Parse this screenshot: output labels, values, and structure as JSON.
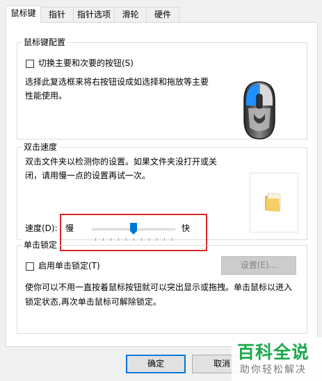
{
  "tabs": [
    {
      "label": "鼠标键"
    },
    {
      "label": "指针"
    },
    {
      "label": "指针选项"
    },
    {
      "label": "滑轮"
    },
    {
      "label": "硬件"
    }
  ],
  "button_config": {
    "title": "鼠标键配置",
    "switch_checkbox_label": "切换主要和次要的按钮(S)",
    "switch_checked": false,
    "description": "选择此复选框来将右按钮设成如选择和拖放等主要性能使用。"
  },
  "double_click": {
    "title": "双击速度",
    "description": "双击文件夹以检测你的设置。如果文件夹没打开或关闭，请用慢一点的设置再试一次。",
    "speed_label": "速度(D):",
    "slow_label": "慢",
    "fast_label": "快",
    "speed_level": 0.5
  },
  "click_lock": {
    "title": "单击锁定",
    "checkbox_label": "启用单击锁定(T)",
    "checked": false,
    "settings_button": "设置(E)...",
    "description": "使你可以不用一直按着鼠标按钮就可以突出显示或拖拽。单击鼠标以进入锁定状态,再次单击鼠标可解除锁定。"
  },
  "footer": {
    "ok": "确定",
    "cancel": "取消"
  },
  "watermark": {
    "line1": "百科全说",
    "line2": "助你轻松解决"
  },
  "colors": {
    "highlight_box": "#d9262b",
    "slider_thumb": "#0078d7",
    "ok_border": "#0078d7",
    "watermark_green": "#19a84a"
  }
}
